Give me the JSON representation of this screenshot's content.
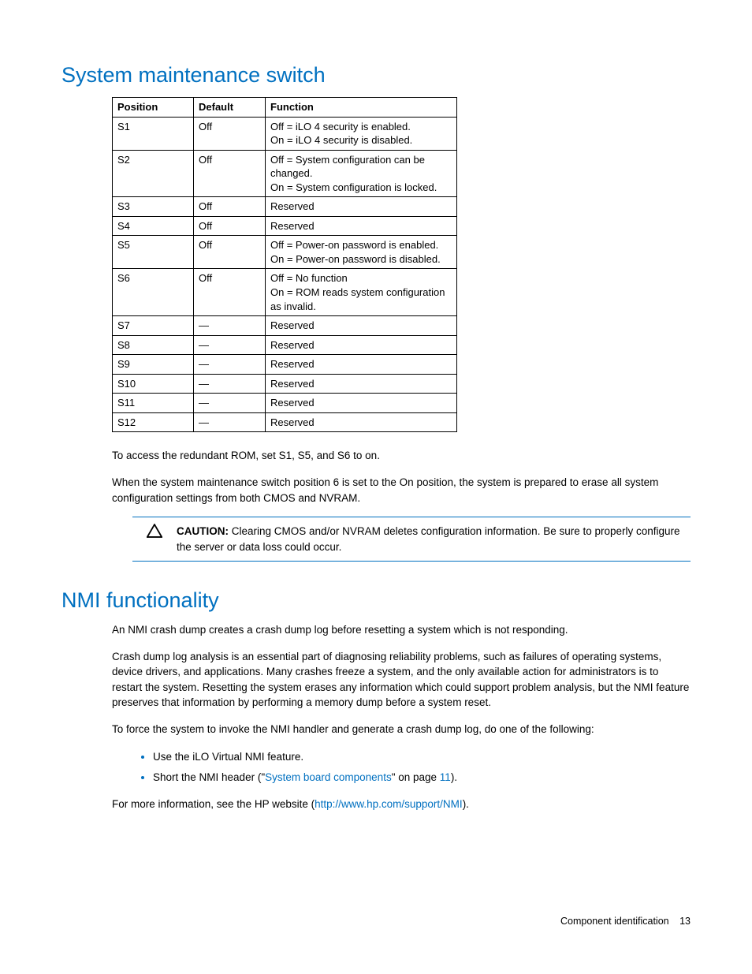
{
  "section1": {
    "heading": "System maintenance switch",
    "table": {
      "headers": [
        "Position",
        "Default",
        "Function"
      ],
      "rows": [
        {
          "position": "S1",
          "default": "Off",
          "function": "Off = iLO 4 security is enabled.\nOn = iLO 4 security is disabled."
        },
        {
          "position": "S2",
          "default": "Off",
          "function": "Off = System configuration can be changed.\nOn = System configuration is locked."
        },
        {
          "position": "S3",
          "default": "Off",
          "function": "Reserved"
        },
        {
          "position": "S4",
          "default": "Off",
          "function": "Reserved"
        },
        {
          "position": "S5",
          "default": "Off",
          "function": "Off = Power-on password is enabled.\nOn = Power-on password is disabled."
        },
        {
          "position": "S6",
          "default": "Off",
          "function": "Off = No function\nOn = ROM reads system configuration as invalid."
        },
        {
          "position": "S7",
          "default": "—",
          "function": "Reserved"
        },
        {
          "position": "S8",
          "default": "—",
          "function": "Reserved"
        },
        {
          "position": "S9",
          "default": "—",
          "function": "Reserved"
        },
        {
          "position": "S10",
          "default": "—",
          "function": "Reserved"
        },
        {
          "position": "S11",
          "default": "—",
          "function": "Reserved"
        },
        {
          "position": "S12",
          "default": "—",
          "function": "Reserved"
        }
      ]
    },
    "para1": "To access the redundant ROM, set S1, S5, and S6 to on.",
    "para2": "When the system maintenance switch position 6 is set to the On position, the system is prepared to erase all system configuration settings from both CMOS and NVRAM.",
    "caution_label": "CAUTION:",
    "caution_text": "Clearing CMOS and/or NVRAM deletes configuration information. Be sure to properly configure the server or data loss could occur."
  },
  "section2": {
    "heading": "NMI functionality",
    "para1": "An NMI crash dump creates a crash dump log before resetting a system which is not responding.",
    "para2": "Crash dump log analysis is an essential part of diagnosing reliability problems, such as failures of operating systems, device drivers, and applications. Many crashes freeze a system, and the only available action for administrators is to restart the system. Resetting the system erases any information which could support problem analysis, but the NMI feature preserves that information by performing a memory dump before a system reset.",
    "para3": "To force the system to invoke the NMI handler and generate a crash dump log, do one of the following:",
    "bullet1": "Use the iLO Virtual NMI feature.",
    "bullet2_pre": "Short the NMI header (\"",
    "bullet2_link": "System board components",
    "bullet2_mid": "\" on page ",
    "bullet2_page": "11",
    "bullet2_post": ").",
    "para4_pre": "For more information, see the HP website (",
    "para4_link": "http://www.hp.com/support/NMI",
    "para4_post": ")."
  },
  "footer": {
    "section": "Component identification",
    "page": "13"
  }
}
